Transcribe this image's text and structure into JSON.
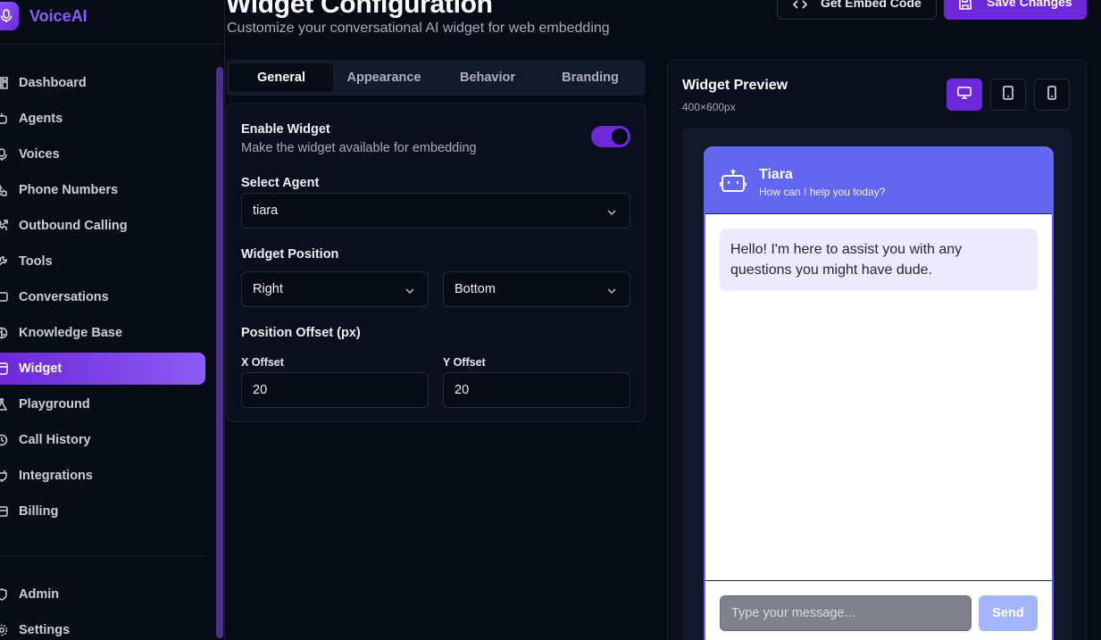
{
  "app": {
    "name": "VoiceAI"
  },
  "sidebar": {
    "items": [
      {
        "label": "Dashboard",
        "icon": "dashboard-icon"
      },
      {
        "label": "Agents",
        "icon": "bot-icon"
      },
      {
        "label": "Voices",
        "icon": "microphone-icon"
      },
      {
        "label": "Phone Numbers",
        "icon": "phone-icon"
      },
      {
        "label": "Outbound Calling",
        "icon": "phone-outgoing-icon"
      },
      {
        "label": "Tools",
        "icon": "wrench-icon"
      },
      {
        "label": "Conversations",
        "icon": "chat-icon"
      },
      {
        "label": "Knowledge Base",
        "icon": "brain-icon"
      },
      {
        "label": "Widget",
        "icon": "widget-icon",
        "active": true
      },
      {
        "label": "Playground",
        "icon": "flask-icon"
      },
      {
        "label": "Call History",
        "icon": "history-icon"
      },
      {
        "label": "Integrations",
        "icon": "plug-icon"
      },
      {
        "label": "Billing",
        "icon": "credit-card-icon"
      }
    ],
    "bottom_items": [
      {
        "label": "Admin",
        "icon": "shield-icon"
      },
      {
        "label": "Settings",
        "icon": "gear-icon"
      }
    ]
  },
  "header": {
    "title": "Widget Configuration",
    "subtitle": "Customize your conversational AI widget for web embedding",
    "embed_label": "Get Embed Code",
    "save_label": "Save Changes"
  },
  "tabs": [
    {
      "label": "General",
      "active": true
    },
    {
      "label": "Appearance"
    },
    {
      "label": "Behavior"
    },
    {
      "label": "Branding"
    }
  ],
  "general": {
    "enable_label": "Enable Widget",
    "enable_desc": "Make the widget available for embedding",
    "enabled": true,
    "agent_label": "Select Agent",
    "agent_value": "tiara",
    "position_label": "Widget Position",
    "position_horizontal": "Right",
    "position_vertical": "Bottom",
    "offset_label": "Position Offset (px)",
    "x_label": "X Offset",
    "x_value": "20",
    "y_label": "Y Offset",
    "y_value": "20"
  },
  "preview": {
    "title": "Widget Preview",
    "size": "400×600px",
    "devices": [
      {
        "name": "desktop-icon",
        "active": true
      },
      {
        "name": "tablet-icon"
      },
      {
        "name": "mobile-icon"
      }
    ],
    "widget": {
      "agent_name": "Tiara",
      "tagline": "How can I help you today?",
      "greeting": "Hello! I'm here to assist you with any questions you might have dude.",
      "input_placeholder": "Type your message...",
      "send_label": "Send"
    }
  },
  "colors": {
    "accent": "#6d28d9",
    "accent_light": "#8b5cf6",
    "widget_primary": "#6366f1",
    "bubble": "#ede9fe",
    "background": "#070b15"
  }
}
